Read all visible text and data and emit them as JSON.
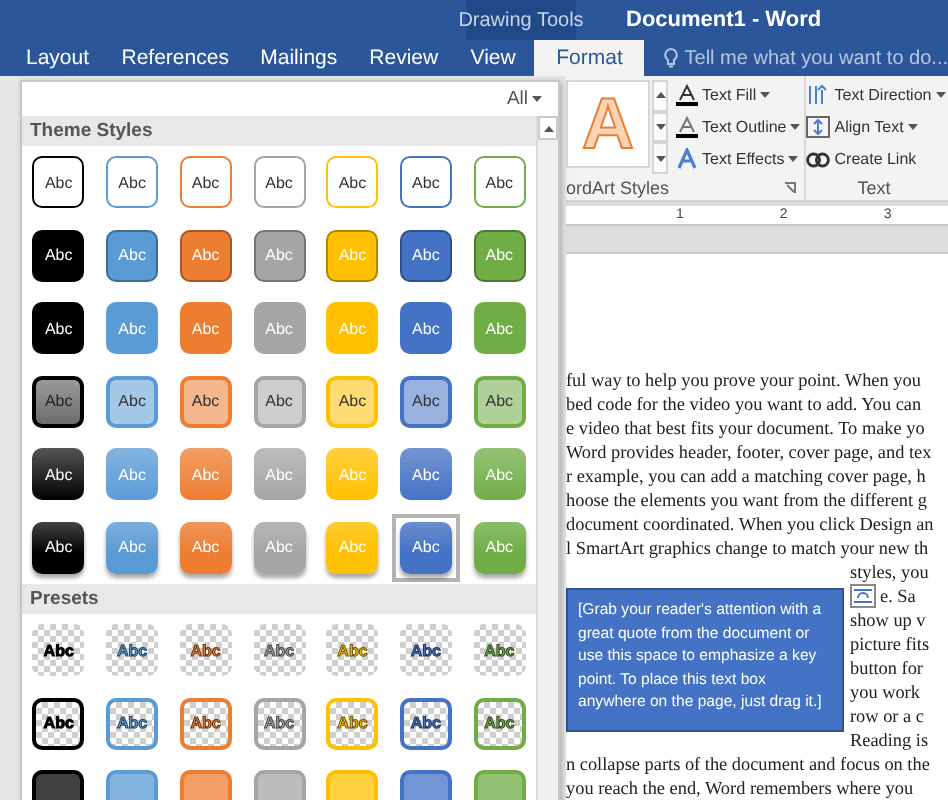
{
  "title_bar": {
    "context_label": "Drawing Tools",
    "title": "Document1 - Word"
  },
  "tabs": [
    {
      "label": "Layout",
      "selected": false
    },
    {
      "label": "References",
      "selected": false
    },
    {
      "label": "Mailings",
      "selected": false
    },
    {
      "label": "Review",
      "selected": false
    },
    {
      "label": "View",
      "selected": false
    },
    {
      "label": "Format",
      "selected": true
    }
  ],
  "tell_me": {
    "placeholder": "Tell me what you want to do..."
  },
  "wordart_styles": {
    "sample": "A",
    "label": "ordArt Styles"
  },
  "text_commands": [
    {
      "label": "Text Fill",
      "kind": "fill",
      "dropdown": true
    },
    {
      "label": "Text Outline",
      "kind": "outline",
      "dropdown": true
    },
    {
      "label": "Text Effects",
      "kind": "effects",
      "dropdown": true
    }
  ],
  "text_group": {
    "label": "Text",
    "commands": [
      {
        "label": "Text Direction",
        "kind": "direction",
        "dropdown": true
      },
      {
        "label": "Align Text",
        "kind": "align",
        "dropdown": true
      },
      {
        "label": "Create Link",
        "kind": "link",
        "dropdown": false
      }
    ]
  },
  "ruler": {
    "marks": [
      "1",
      "2",
      "3"
    ]
  },
  "document": {
    "lines": [
      "ful way to help you prove your point. When you",
      "bed code for the video you want to add. You can",
      "e video that best fits your document. To make yo",
      "Word provides header, footer, cover page, and tex",
      "r example, you can add a matching cover page, h",
      "hoose the elements you want from the different g",
      "document coordinated. When you click Design an",
      "l SmartArt graphics change to match your new th"
    ],
    "text_box": "[Grab your reader's attention with a great quote from the document or use this space to emphasize a key point. To place this text box anywhere on the page, just drag it.]",
    "side_lines": [
      "styles, you",
      "e. Sa",
      "show up v",
      "picture fits",
      "button for",
      "you work",
      "row or a c",
      "Reading is"
    ],
    "lines_after": [
      "n collapse parts of the document and focus on the",
      "you reach the end, Word remembers where you"
    ]
  },
  "gallery": {
    "filter": "All",
    "sections": [
      {
        "title": "Theme Styles",
        "rows": [
          {
            "kind": "outline",
            "cells": [
              {
                "label": "Abc",
                "color": "#000000",
                "selected": false
              },
              {
                "label": "Abc",
                "color": "#5b9bd5",
                "selected": false
              },
              {
                "label": "Abc",
                "color": "#ed7d31",
                "selected": false
              },
              {
                "label": "Abc",
                "color": "#a5a5a5",
                "selected": false
              },
              {
                "label": "Abc",
                "color": "#ffc000",
                "selected": false
              },
              {
                "label": "Abc",
                "color": "#4472c4",
                "selected": false
              },
              {
                "label": "Abc",
                "color": "#70ad47",
                "selected": false
              }
            ]
          },
          {
            "kind": "fill",
            "cells": [
              {
                "label": "Abc",
                "color": "#000000",
                "selected": false
              },
              {
                "label": "Abc",
                "color": "#5b9bd5",
                "selected": false
              },
              {
                "label": "Abc",
                "color": "#ed7d31",
                "selected": false
              },
              {
                "label": "Abc",
                "color": "#a5a5a5",
                "selected": false
              },
              {
                "label": "Abc",
                "color": "#ffc000",
                "selected": false
              },
              {
                "label": "Abc",
                "color": "#4472c4",
                "selected": false
              },
              {
                "label": "Abc",
                "color": "#70ad47",
                "selected": false
              }
            ]
          },
          {
            "kind": "flat",
            "cells": [
              {
                "label": "Abc",
                "color": "#000000",
                "selected": false
              },
              {
                "label": "Abc",
                "color": "#5b9bd5",
                "selected": false
              },
              {
                "label": "Abc",
                "color": "#ed7d31",
                "selected": false
              },
              {
                "label": "Abc",
                "color": "#a5a5a5",
                "selected": false
              },
              {
                "label": "Abc",
                "color": "#ffc000",
                "selected": false
              },
              {
                "label": "Abc",
                "color": "#4472c4",
                "selected": false
              },
              {
                "label": "Abc",
                "color": "#70ad47",
                "selected": false
              }
            ]
          },
          {
            "kind": "light",
            "cells": [
              {
                "label": "Abc",
                "color": "#000000",
                "selected": false
              },
              {
                "label": "Abc",
                "color": "#5b9bd5",
                "selected": false
              },
              {
                "label": "Abc",
                "color": "#ed7d31",
                "selected": false
              },
              {
                "label": "Abc",
                "color": "#a5a5a5",
                "selected": false
              },
              {
                "label": "Abc",
                "color": "#ffc000",
                "selected": false
              },
              {
                "label": "Abc",
                "color": "#4472c4",
                "selected": false
              },
              {
                "label": "Abc",
                "color": "#70ad47",
                "selected": false
              }
            ]
          },
          {
            "kind": "gradient",
            "cells": [
              {
                "label": "Abc",
                "color": "#000000",
                "selected": false
              },
              {
                "label": "Abc",
                "color": "#5b9bd5",
                "selected": false
              },
              {
                "label": "Abc",
                "color": "#ed7d31",
                "selected": false
              },
              {
                "label": "Abc",
                "color": "#a5a5a5",
                "selected": false
              },
              {
                "label": "Abc",
                "color": "#ffc000",
                "selected": false
              },
              {
                "label": "Abc",
                "color": "#4472c4",
                "selected": false
              },
              {
                "label": "Abc",
                "color": "#70ad47",
                "selected": false
              }
            ]
          },
          {
            "kind": "intense",
            "cells": [
              {
                "label": "Abc",
                "color": "#000000",
                "selected": false
              },
              {
                "label": "Abc",
                "color": "#5b9bd5",
                "selected": false
              },
              {
                "label": "Abc",
                "color": "#ed7d31",
                "selected": false
              },
              {
                "label": "Abc",
                "color": "#a5a5a5",
                "selected": false
              },
              {
                "label": "Abc",
                "color": "#ffc000",
                "selected": false
              },
              {
                "label": "Abc",
                "color": "#4472c4",
                "selected": true
              },
              {
                "label": "Abc",
                "color": "#70ad47",
                "selected": false
              }
            ]
          }
        ]
      },
      {
        "title": "Presets",
        "rows": [
          {
            "kind": "clear",
            "cells": [
              {
                "label": "Abc",
                "color": "#000000",
                "selected": false
              },
              {
                "label": "Abc",
                "color": "#5b9bd5",
                "selected": false
              },
              {
                "label": "Abc",
                "color": "#ed7d31",
                "selected": false
              },
              {
                "label": "Abc",
                "color": "#a5a5a5",
                "selected": false
              },
              {
                "label": "Abc",
                "color": "#ffc000",
                "selected": false
              },
              {
                "label": "Abc",
                "color": "#4472c4",
                "selected": false
              },
              {
                "label": "Abc",
                "color": "#70ad47",
                "selected": false
              }
            ]
          },
          {
            "kind": "clear-outline",
            "cells": [
              {
                "label": "Abc",
                "color": "#000000",
                "selected": false
              },
              {
                "label": "Abc",
                "color": "#5b9bd5",
                "selected": false
              },
              {
                "label": "Abc",
                "color": "#ed7d31",
                "selected": false
              },
              {
                "label": "Abc",
                "color": "#a5a5a5",
                "selected": false
              },
              {
                "label": "Abc",
                "color": "#ffc000",
                "selected": false
              },
              {
                "label": "Abc",
                "color": "#4472c4",
                "selected": false
              },
              {
                "label": "Abc",
                "color": "#70ad47",
                "selected": false
              }
            ]
          },
          {
            "kind": "clear-fill",
            "cells": [
              {
                "color": "#000000",
                "selected": false
              },
              {
                "color": "#5b9bd5",
                "selected": false
              },
              {
                "color": "#ed7d31",
                "selected": false
              },
              {
                "color": "#a5a5a5",
                "selected": false
              },
              {
                "color": "#ffc000",
                "selected": false
              },
              {
                "color": "#4472c4",
                "selected": false
              },
              {
                "color": "#70ad47",
                "selected": false
              }
            ]
          }
        ]
      }
    ]
  }
}
